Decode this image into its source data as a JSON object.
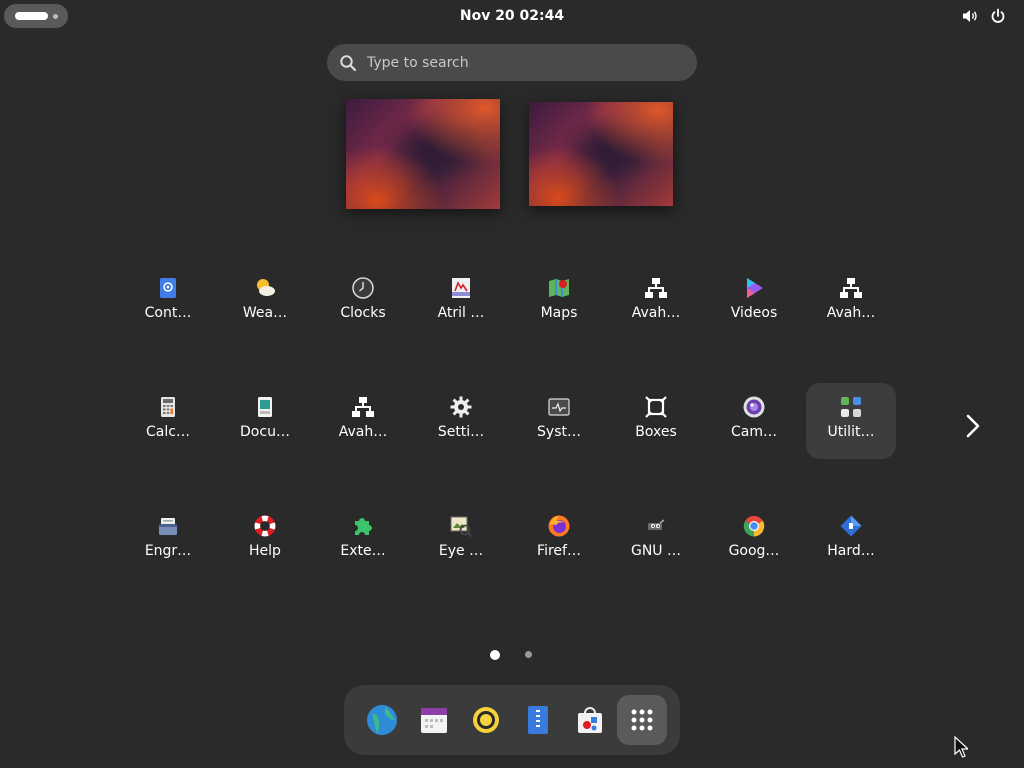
{
  "topbar": {
    "datetime": "Nov 20  02:44"
  },
  "search": {
    "placeholder": "Type to search"
  },
  "apps": [
    {
      "label": "Cont…",
      "icon": "contacts-icon"
    },
    {
      "label": "Wea…",
      "icon": "weather-icon"
    },
    {
      "label": "Clocks",
      "icon": "clocks-icon"
    },
    {
      "label": "Atril …",
      "icon": "atril-document-viewer-icon"
    },
    {
      "label": "Maps",
      "icon": "maps-icon"
    },
    {
      "label": "Avah…",
      "icon": "network-icon"
    },
    {
      "label": "Videos",
      "icon": "videos-icon"
    },
    {
      "label": "Avah…",
      "icon": "network-icon"
    },
    {
      "label": "Calc…",
      "icon": "calculator-icon"
    },
    {
      "label": "Docu…",
      "icon": "document-scanner-icon"
    },
    {
      "label": "Avah…",
      "icon": "network-icon"
    },
    {
      "label": "Setti…",
      "icon": "settings-gear-icon"
    },
    {
      "label": "Syst…",
      "icon": "system-monitor-icon"
    },
    {
      "label": "Boxes",
      "icon": "boxes-icon"
    },
    {
      "label": "Cam…",
      "icon": "camera-icon"
    },
    {
      "label": "Utilit…",
      "icon": "utilities-folder-icon"
    },
    {
      "label": "Engr…",
      "icon": "engrampa-archive-icon"
    },
    {
      "label": "Help",
      "icon": "help-lifebuoy-icon"
    },
    {
      "label": "Exte…",
      "icon": "extensions-puzzle-icon"
    },
    {
      "label": "Eye …",
      "icon": "eye-of-mate-icon"
    },
    {
      "label": "Firef…",
      "icon": "firefox-icon"
    },
    {
      "label": "GNU …",
      "icon": "gnu-image-icon"
    },
    {
      "label": "Goog…",
      "icon": "google-chrome-icon"
    },
    {
      "label": "Hard…",
      "icon": "hardinfo-icon"
    }
  ],
  "highlighted_app_index": 15,
  "pagination": {
    "current_page": 1,
    "page_count": 2
  },
  "dash": [
    {
      "icon": "web-browser-icon"
    },
    {
      "icon": "calendar-icon"
    },
    {
      "icon": "rhythmbox-music-icon"
    },
    {
      "icon": "text-editor-icon"
    },
    {
      "icon": "software-store-icon"
    },
    {
      "icon": "show-apps-grid-icon",
      "active": true
    }
  ],
  "colors": {
    "background": "#2a2a2a",
    "topbar_pill": "#5a5a5a",
    "search_bg": "#4a4a4a",
    "dash_bg": "#3b3b3b",
    "highlight": "#3d3d3d"
  }
}
